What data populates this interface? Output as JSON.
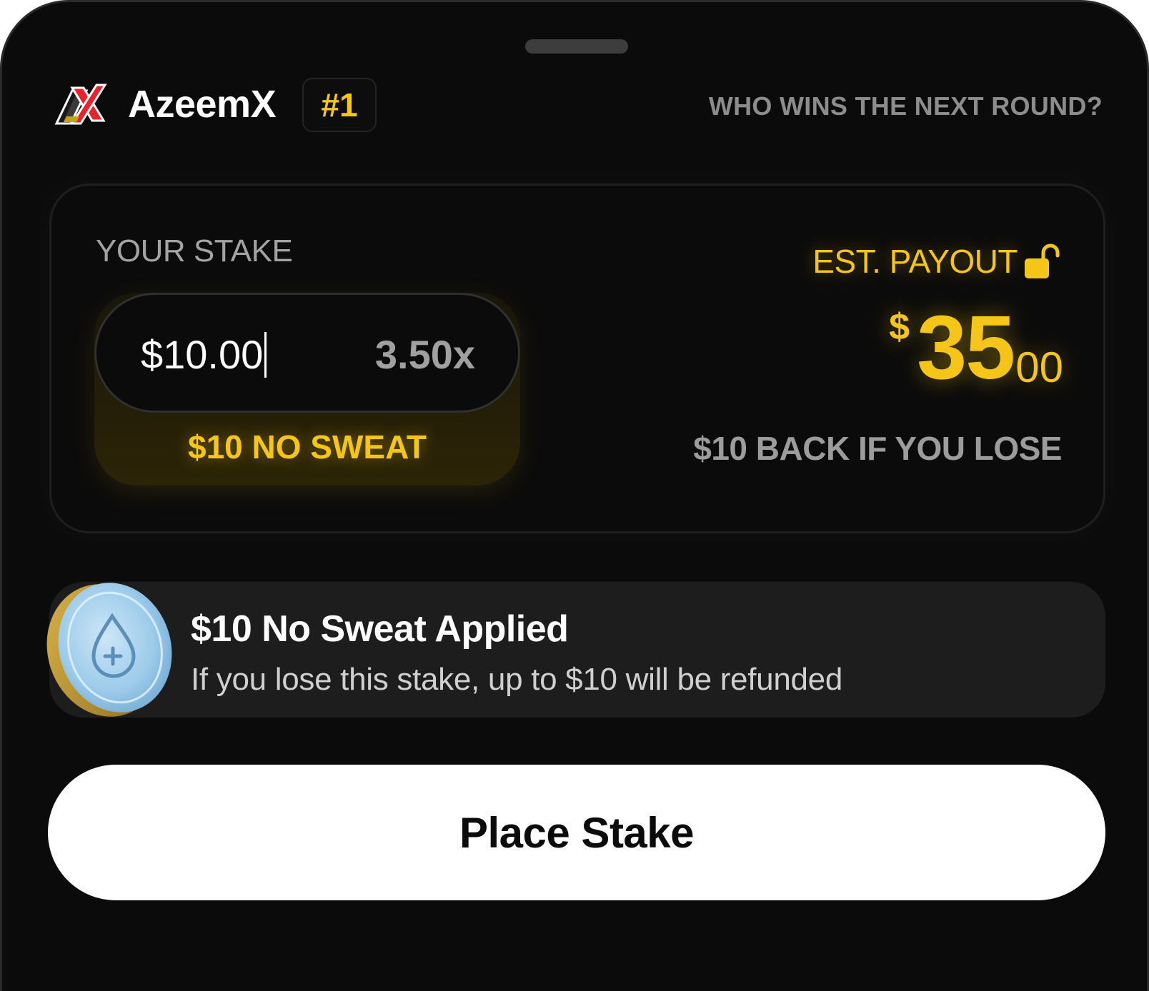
{
  "header": {
    "team_name": "AzeemX",
    "rank": "#1",
    "question": "WHO WINS THE NEXT ROUND?",
    "logo_icon": "azeemx-logo-icon"
  },
  "stake": {
    "label": "YOUR STAKE",
    "input_value": "$10.00",
    "multiplier": "3.50x",
    "promo_tag": "$10 NO SWEAT"
  },
  "payout": {
    "label": "EST. PAYOUT",
    "icon": "unlock-icon",
    "currency": "$",
    "amount_major": "35",
    "amount_minor": "00",
    "note": "$10 BACK IF YOU LOSE"
  },
  "promo": {
    "icon": "no-sweat-coin-icon",
    "title": "$10 No Sweat Applied",
    "description": "If you lose this stake, up to $10 will be refunded"
  },
  "cta": {
    "label": "Place Stake"
  },
  "colors": {
    "background": "#0b0b0b",
    "accent": "#f5c518",
    "muted_text": "#9c9c9c",
    "banner": "#1d1d1d",
    "button": "#ffffff"
  }
}
